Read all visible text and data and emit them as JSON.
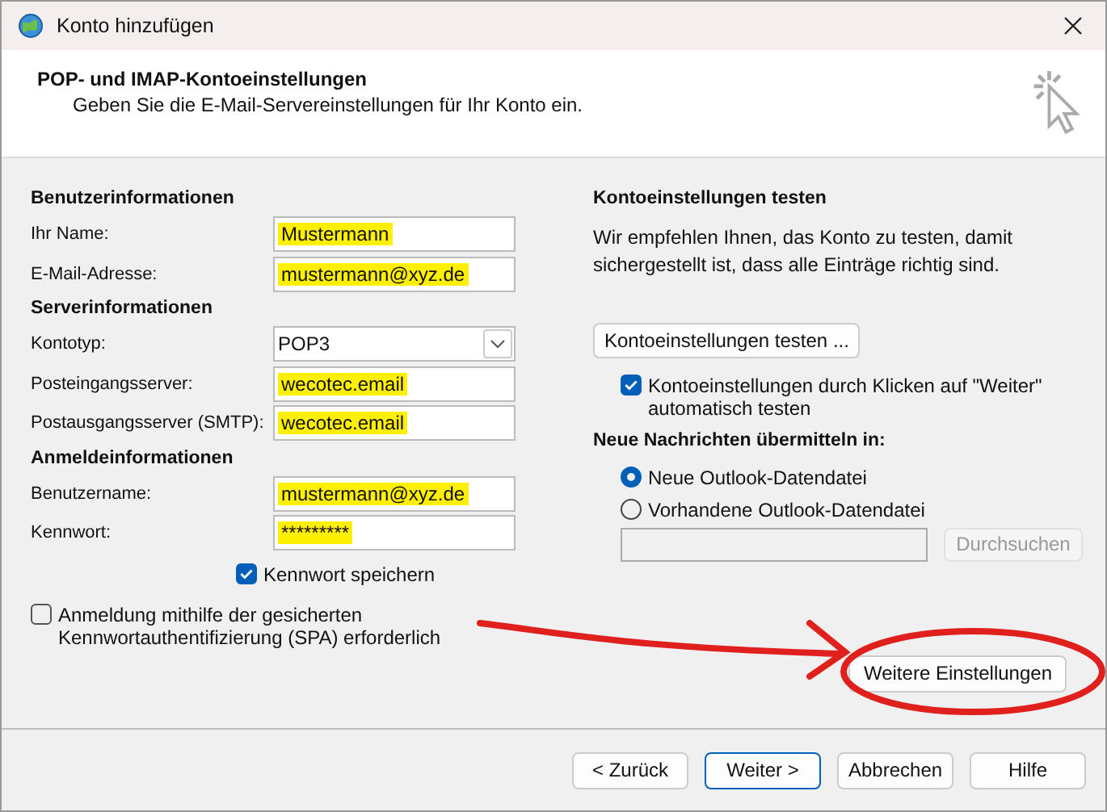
{
  "window": {
    "title": "Konto hinzufügen"
  },
  "header": {
    "title": "POP- und IMAP-Kontoeinstellungen",
    "subtitle": "Geben Sie die E-Mail-Servereinstellungen für Ihr Konto ein."
  },
  "left": {
    "sections": [
      {
        "title": "Benutzerinformationen",
        "fields": [
          {
            "label": "Ihr Name:",
            "kind": "text",
            "value": "Mustermann",
            "highlighted": true
          },
          {
            "label": "E-Mail-Adresse:",
            "kind": "text",
            "value": "mustermann@xyz.de",
            "highlighted": true
          }
        ]
      },
      {
        "title": "Serverinformationen",
        "fields": [
          {
            "label": "Kontotyp:",
            "kind": "dropdown",
            "value": "POP3",
            "highlighted": false
          },
          {
            "label": "Posteingangsserver:",
            "kind": "text",
            "value": "wecotec.email",
            "highlighted": true
          },
          {
            "label": "Postausgangsserver (SMTP):",
            "kind": "text",
            "value": "wecotec.email",
            "highlighted": true
          }
        ]
      },
      {
        "title": "Anmeldeinformationen",
        "fields": [
          {
            "label": "Benutzername:",
            "kind": "text",
            "value": "mustermann@xyz.de",
            "highlighted": true
          },
          {
            "label": "Kennwort:",
            "kind": "text",
            "value": "*********",
            "highlighted": true
          }
        ]
      }
    ],
    "save_password": {
      "label": "Kennwort speichern",
      "checked": true
    },
    "spa": {
      "label": "Anmeldung mithilfe der gesicherten Kennwortauthentifizierung (SPA) erforderlich",
      "checked": false
    }
  },
  "right": {
    "title": "Kontoeinstellungen testen",
    "text": "Wir empfehlen Ihnen, das Konto zu testen, damit sichergestellt ist, dass alle Einträge richtig sind.",
    "test_button": "Kontoeinstellungen testen ...",
    "auto_test": {
      "label": "Kontoeinstellungen durch Klicken auf \"Weiter\" automatisch testen",
      "checked": true
    },
    "deliver_title": "Neue Nachrichten übermitteln in:",
    "options": [
      {
        "label": "Neue Outlook-Datendatei",
        "selected": true
      },
      {
        "label": "Vorhandene Outlook-Datendatei",
        "selected": false
      }
    ],
    "browse_button": {
      "label": "Durchsuchen",
      "disabled": true
    },
    "more_button": "Weitere Einstellungen"
  },
  "annotation": {
    "arrow": true,
    "circle": true
  },
  "buttons": [
    {
      "label": "< Zurück",
      "focused": false
    },
    {
      "label": "Weiter >",
      "focused": true
    },
    {
      "label": "Abbrechen",
      "focused": false
    },
    {
      "label": "Hilfe",
      "focused": false
    }
  ]
}
